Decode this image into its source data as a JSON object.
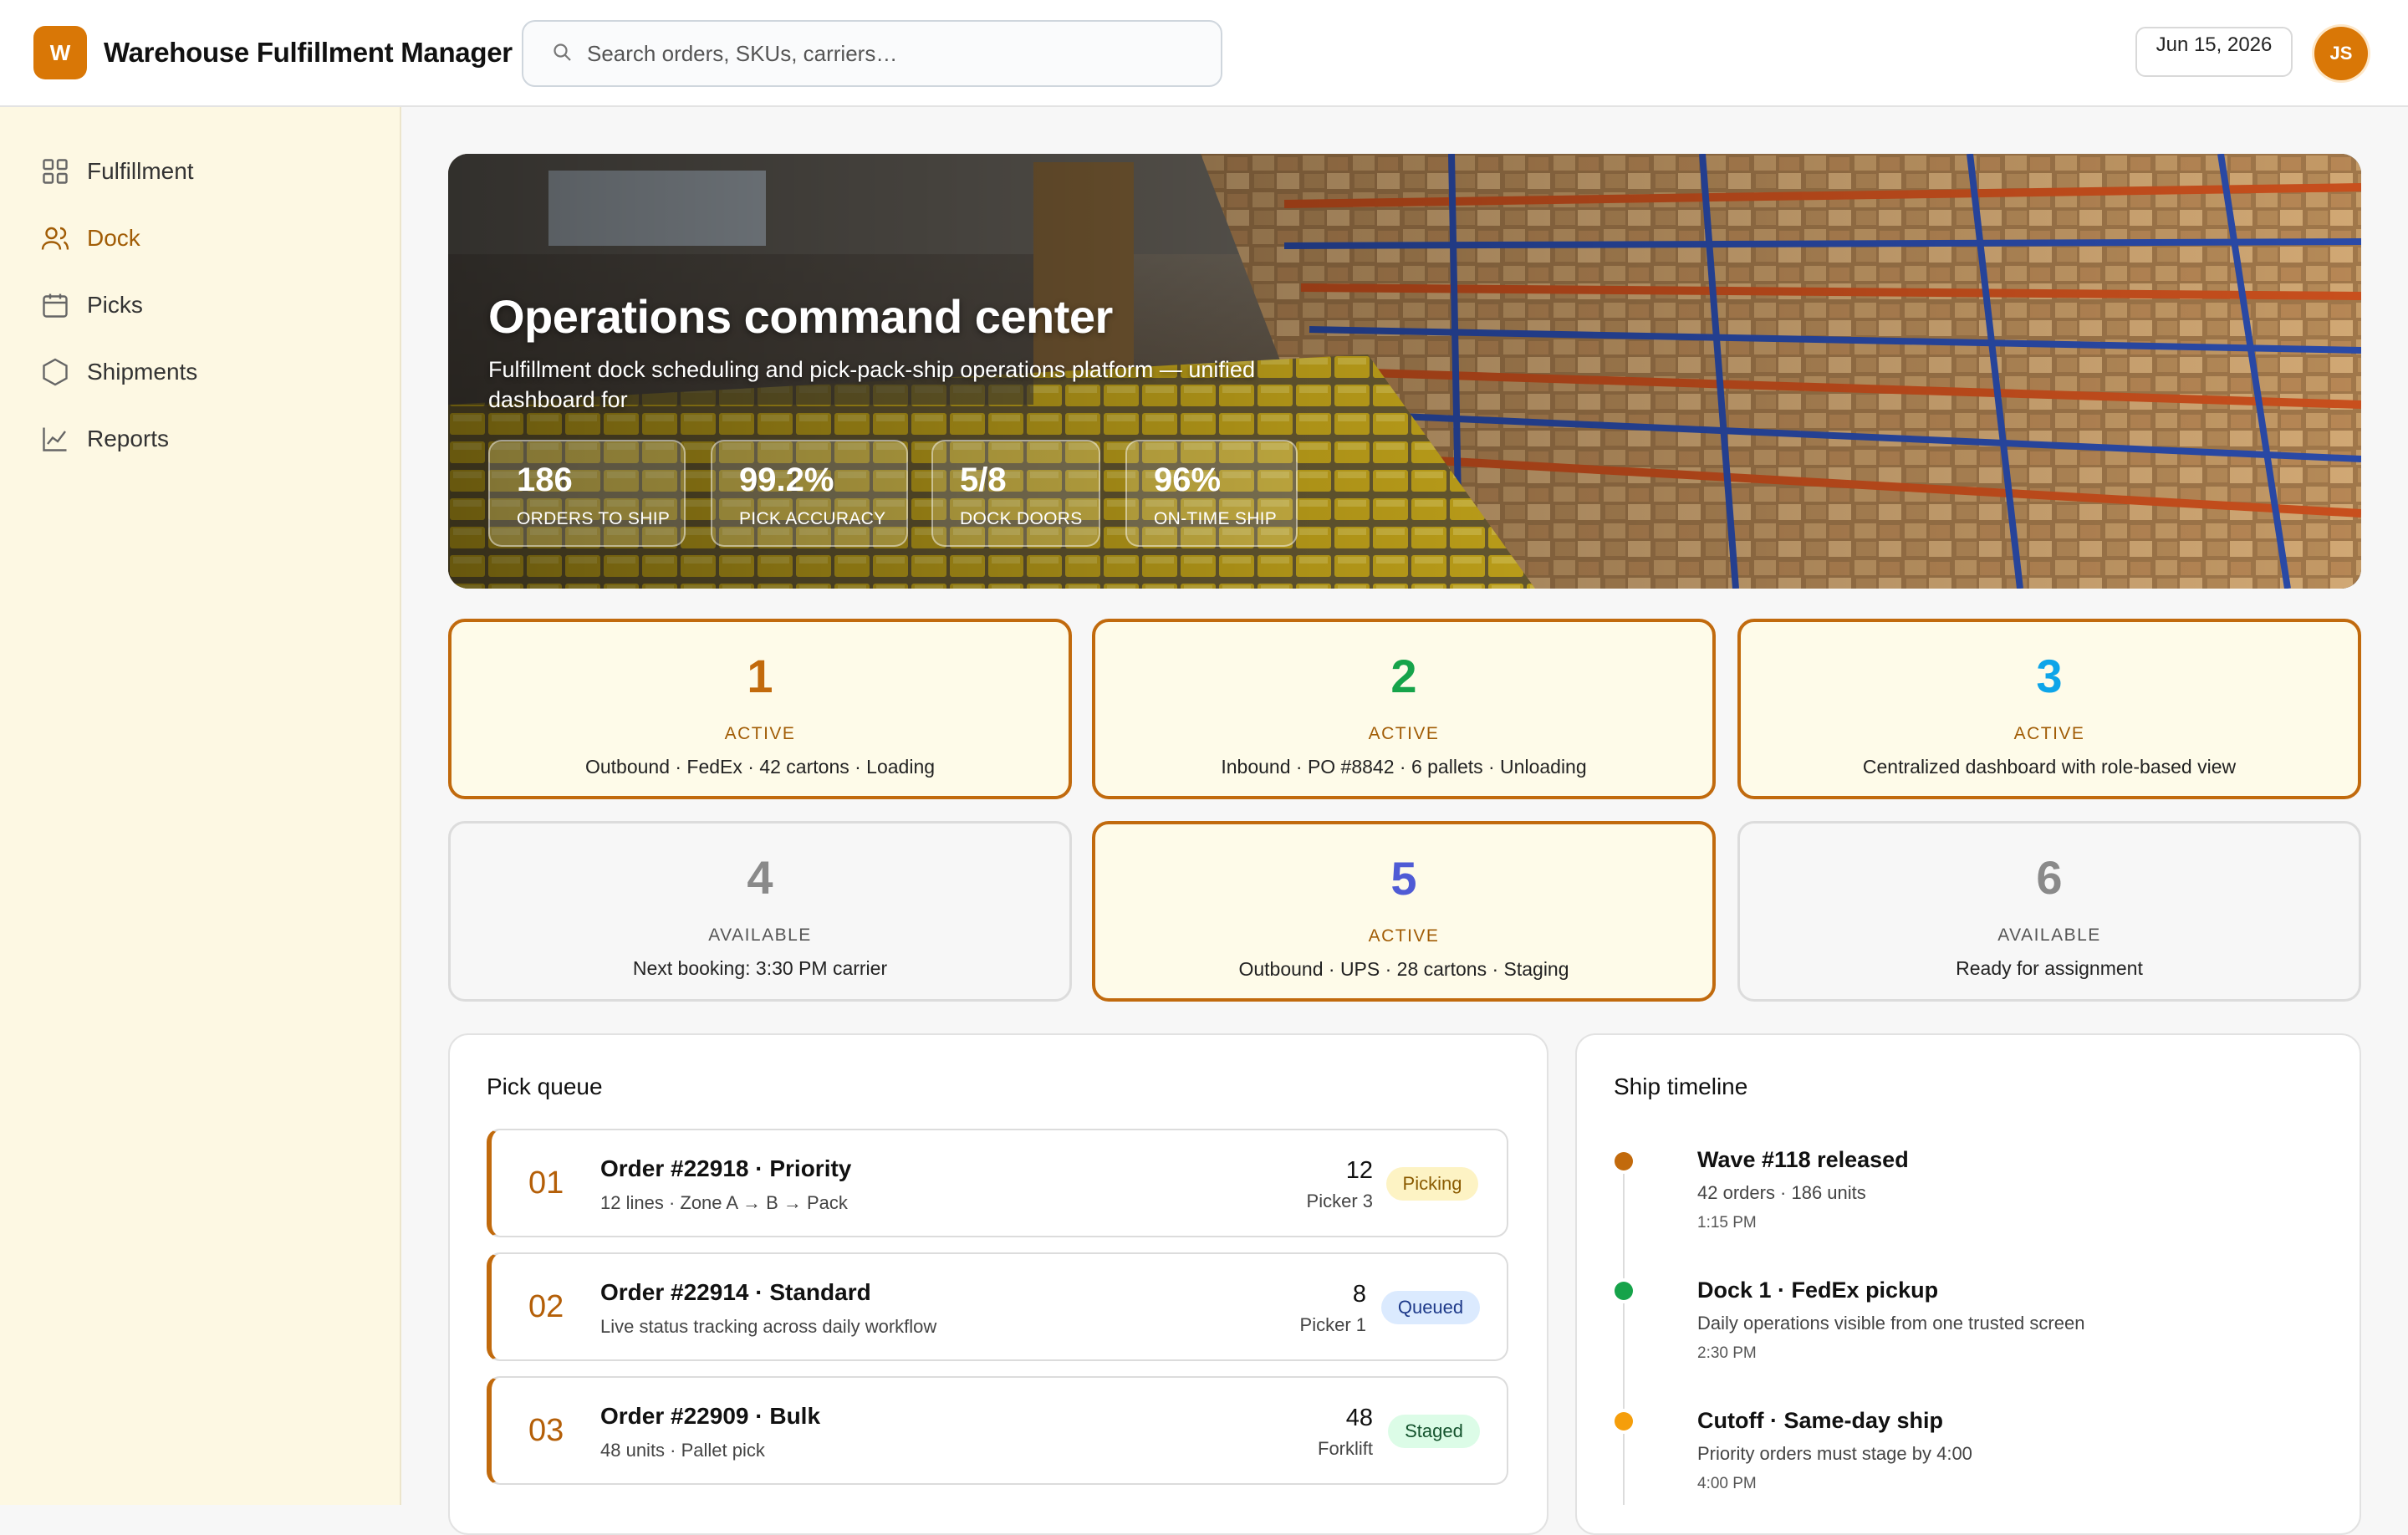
{
  "app": {
    "logo_letter": "W",
    "title": "Warehouse Fulfillment Manager"
  },
  "search": {
    "placeholder": "Search orders, SKUs, carriers…"
  },
  "header": {
    "date": "Jun 15, 2026",
    "avatar_initials": "JS"
  },
  "sidebar": {
    "items": [
      {
        "label": "Fulfillment",
        "icon": "grid-icon",
        "active": false
      },
      {
        "label": "Dock",
        "icon": "users-icon",
        "active": true
      },
      {
        "label": "Picks",
        "icon": "calendar-icon",
        "active": false
      },
      {
        "label": "Shipments",
        "icon": "hexagon-icon",
        "active": false
      },
      {
        "label": "Reports",
        "icon": "line-chart-icon",
        "active": false
      }
    ]
  },
  "hero": {
    "title": "Operations command center",
    "subtitle": "Fulfillment dock scheduling and pick-pack-ship operations platform — unified dashboard for",
    "stats": [
      {
        "value": "186",
        "label": "ORDERS TO SHIP"
      },
      {
        "value": "99.2%",
        "label": "PICK ACCURACY"
      },
      {
        "value": "5/8",
        "label": "DOCK DOORS"
      },
      {
        "value": "96%",
        "label": "ON-TIME SHIP"
      }
    ]
  },
  "docks": [
    {
      "number": "1",
      "status": "ACTIVE",
      "description": "Outbound · FedEx · 42 cartons · Loading",
      "color": "#c26a0c"
    },
    {
      "number": "2",
      "status": "ACTIVE",
      "description": "Inbound · PO #8842 · 6 pallets · Unloading",
      "color": "#16a34a"
    },
    {
      "number": "3",
      "status": "ACTIVE",
      "description": "Centralized dashboard with role-based view",
      "color": "#0ea5e9"
    },
    {
      "number": "4",
      "status": "AVAILABLE",
      "description": "Next booking: 3:30 PM carrier",
      "color": "#8a8a8a"
    },
    {
      "number": "5",
      "status": "ACTIVE",
      "description": "Outbound · UPS · 28 cartons · Staging",
      "color": "#4f5bd5"
    },
    {
      "number": "6",
      "status": "AVAILABLE",
      "description": "Ready for assignment",
      "color": "#8a8a8a"
    }
  ],
  "pick_queue": {
    "title": "Pick queue",
    "rows": [
      {
        "index": "01",
        "name": "Order #22918 · Priority",
        "meta": "12 lines · Zone A → B → Pack",
        "count": "12",
        "assignee": "Picker 3",
        "badge": "Picking",
        "badge_bg": "#fdf3c4",
        "badge_fg": "#8a5a00"
      },
      {
        "index": "02",
        "name": "Order #22914 · Standard",
        "meta": "Live status tracking across daily workflow",
        "count": "8",
        "assignee": "Picker 1",
        "badge": "Queued",
        "badge_bg": "#dbeafe",
        "badge_fg": "#1e3a8a"
      },
      {
        "index": "03",
        "name": "Order #22909 · Bulk",
        "meta": "48 units · Pallet pick",
        "count": "48",
        "assignee": "Forklift",
        "badge": "Staged",
        "badge_bg": "#dcfce7",
        "badge_fg": "#14532d"
      }
    ]
  },
  "ship_timeline": {
    "title": "Ship timeline",
    "events": [
      {
        "title": "Wave #118 released",
        "description": "42 orders · 186 units",
        "time": "1:15 PM",
        "color": "#c26a0c"
      },
      {
        "title": "Dock 1 · FedEx pickup",
        "description": "Daily operations visible from one trusted screen",
        "time": "2:30 PM",
        "color": "#16a34a"
      },
      {
        "title": "Cutoff · Same-day ship",
        "description": "Priority orders must stage by 4:00",
        "time": "4:00 PM",
        "color": "#f59e0b"
      }
    ]
  }
}
